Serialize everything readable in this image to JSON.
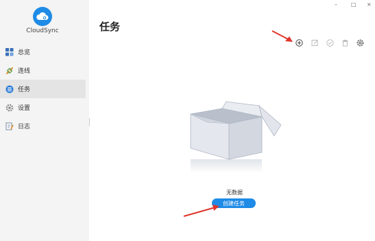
{
  "app": {
    "name": "CloudSync"
  },
  "window": {
    "minimize": "–",
    "maximize": "□",
    "close": "×"
  },
  "sidebar": {
    "items": [
      {
        "label": "总览",
        "icon": "overview-icon"
      },
      {
        "label": "连线",
        "icon": "link-icon"
      },
      {
        "label": "任务",
        "icon": "task-icon",
        "active": true
      },
      {
        "label": "设置",
        "icon": "settings-icon"
      },
      {
        "label": "日志",
        "icon": "log-icon"
      }
    ]
  },
  "main": {
    "title": "任务",
    "toolbar": [
      "add-icon",
      "edit-icon",
      "check-icon",
      "delete-icon",
      "gear-icon"
    ],
    "empty_state": {
      "text": "无数据",
      "button_label": "创建任务"
    }
  },
  "colors": {
    "accent": "#1e8be6",
    "arrow": "#e2342b",
    "sidebar_bg": "#f4f4f4",
    "active_bg": "#e4e4e4"
  }
}
